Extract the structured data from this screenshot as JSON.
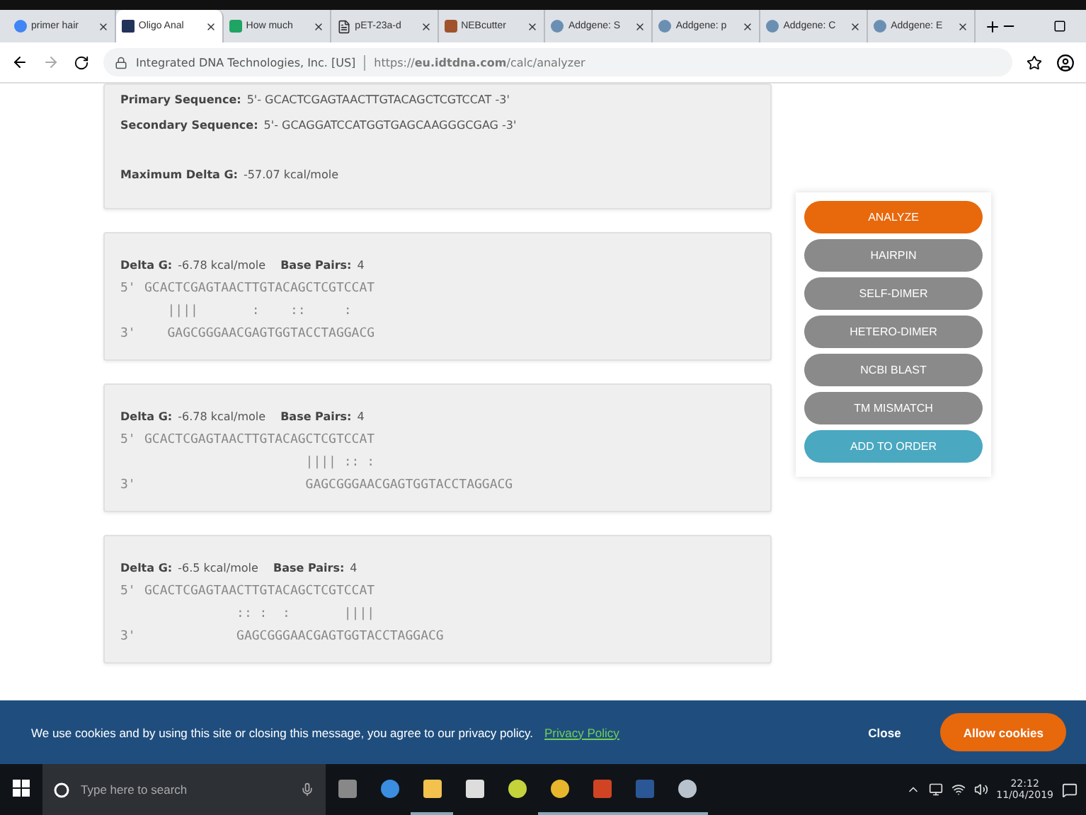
{
  "browser": {
    "tabs": [
      {
        "label": "primer hair",
        "selected": false
      },
      {
        "label": "Oligo Anal",
        "selected": true
      },
      {
        "label": "How much",
        "selected": false
      },
      {
        "label": "pET-23a-d",
        "selected": false
      },
      {
        "label": "NEBcutter",
        "selected": false
      },
      {
        "label": "Addgene: S",
        "selected": false
      },
      {
        "label": "Addgene: p",
        "selected": false
      },
      {
        "label": "Addgene: C",
        "selected": false
      },
      {
        "label": "Addgene: E",
        "selected": false
      }
    ],
    "site_name": "Integrated DNA Technologies, Inc. [US]",
    "url": "https://**eu.idtdna.com**/calc/analyzer"
  },
  "summary": {
    "primary_label": "Primary Sequence:",
    "primary": "5'- GCACTCGAGTAACTTGTACAGCTCGTCCAT -3'",
    "secondary_label": "Secondary Sequence:",
    "secondary": "5'- GCAGGATCCATGGTGAGCAAGGGCGAG -3'",
    "max_label": "Maximum Delta G:",
    "max": "-57.07 kcal/mole"
  },
  "results": [
    {
      "delta_label": "Delta G:",
      "delta": "-6.78 kcal/mole",
      "pairs_label": "Base Pairs:",
      "pairs": "4",
      "top_end": "5'",
      "top": "GCACTCGAGTAACTTGTACAGCTCGTCCAT",
      "match": "   ||||       :    ::     :",
      "bottom_end": "3'",
      "bottom": "   GAGCGGGAACGAGTGGTACCTAGGACG"
    },
    {
      "delta_label": "Delta G:",
      "delta": "-6.78 kcal/mole",
      "pairs_label": "Base Pairs:",
      "pairs": "4",
      "top_end": "5'",
      "top": "GCACTCGAGTAACTTGTACAGCTCGTCCAT",
      "match": "                     |||| :: :",
      "bottom_end": "3'",
      "bottom": "                     GAGCGGGAACGAGTGGTACCTAGGACG"
    },
    {
      "delta_label": "Delta G:",
      "delta": "-6.5 kcal/mole",
      "pairs_label": "Base Pairs:",
      "pairs": "4",
      "top_end": "5'",
      "top": "GCACTCGAGTAACTTGTACAGCTCGTCCAT",
      "match": "            :: :  :       ||||",
      "bottom_end": "3'",
      "bottom": "            GAGCGGGAACGAGTGGTACCTAGGACG"
    }
  ],
  "actions": [
    {
      "label": "ANALYZE",
      "kind": "primary"
    },
    {
      "label": "HAIRPIN",
      "kind": "tool"
    },
    {
      "label": "SELF-DIMER",
      "kind": "tool"
    },
    {
      "label": "HETERO-DIMER",
      "kind": "tool"
    },
    {
      "label": "NCBI BLAST",
      "kind": "tool"
    },
    {
      "label": "TM MISMATCH",
      "kind": "tool"
    },
    {
      "label": "ADD TO ORDER",
      "kind": "order"
    }
  ],
  "cookie_banner": {
    "message": "We use cookies and by using this site or closing this message, you agree to our privacy policy.",
    "link": "Privacy Policy",
    "close": "Close",
    "allow": "Allow cookies"
  },
  "taskbar": {
    "search_placeholder": "Type here to search",
    "apps": [
      {
        "kind": "taskview",
        "active": false
      },
      {
        "kind": "edge",
        "active": false
      },
      {
        "kind": "explorer",
        "active": true
      },
      {
        "kind": "store",
        "active": false
      },
      {
        "kind": "app",
        "active": false
      },
      {
        "kind": "chrome",
        "active": true
      },
      {
        "kind": "powerpoint",
        "active": true
      },
      {
        "kind": "word",
        "active": true
      },
      {
        "kind": "tool",
        "active": true
      }
    ],
    "time": "22:12",
    "date": "11/04/2019"
  }
}
